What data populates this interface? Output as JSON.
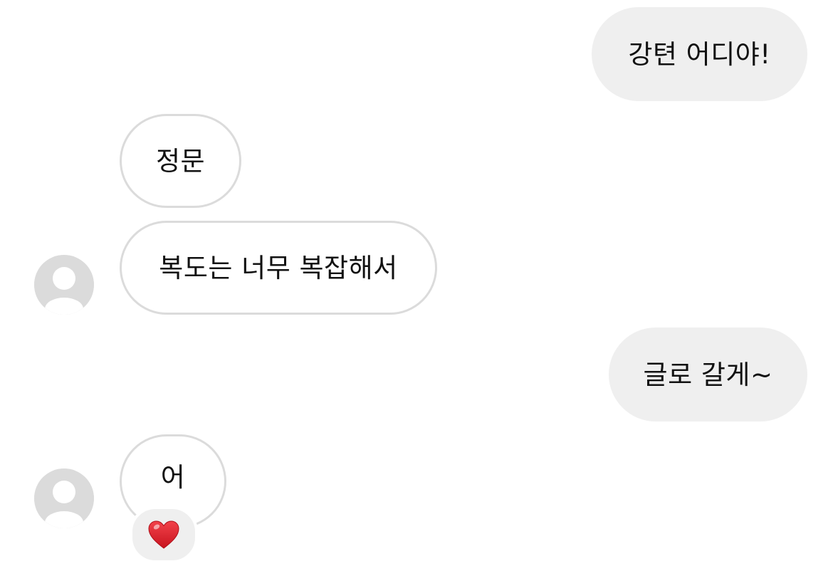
{
  "conversation": {
    "messages": [
      {
        "id": "m1",
        "direction": "outgoing",
        "text": "강텬 어디야!"
      },
      {
        "id": "m2",
        "direction": "incoming",
        "text": "정문"
      },
      {
        "id": "m3",
        "direction": "incoming",
        "text": "복도는 너무 복잡해서",
        "show_avatar": true
      },
      {
        "id": "m4",
        "direction": "outgoing",
        "text": "글로 갈게~"
      },
      {
        "id": "m5",
        "direction": "incoming",
        "text": "어",
        "show_avatar": true,
        "reaction": "heart-icon"
      }
    ]
  },
  "colors": {
    "outgoing_bubble": "#efefef",
    "incoming_bubble_border": "#dbdbdb",
    "avatar_placeholder": "#dbdbdb",
    "reaction_heart": "#e0242f"
  }
}
